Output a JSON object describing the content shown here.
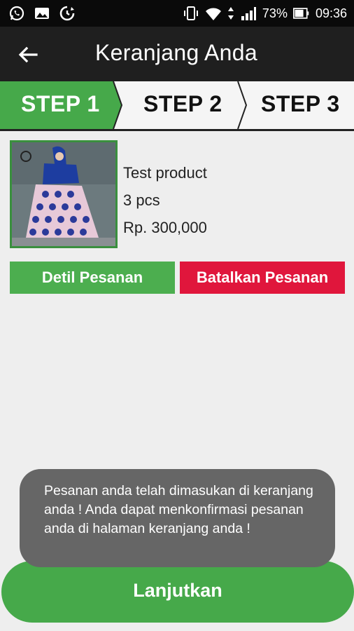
{
  "status_bar": {
    "battery_percent": "73%",
    "time": "09:36",
    "left_icons": [
      "whatsapp-icon",
      "gallery-icon",
      "sync-icon"
    ],
    "right_icons": [
      "vibrate-icon",
      "wifi-icon",
      "data-arrows-icon",
      "signal-icon",
      "battery-icon"
    ]
  },
  "app_bar": {
    "title": "Keranjang Anda",
    "back_icon": "arrow-back-icon"
  },
  "steps": [
    {
      "label": "STEP 1",
      "active": true
    },
    {
      "label": "STEP 2",
      "active": false
    },
    {
      "label": "STEP 3",
      "active": false
    }
  ],
  "product": {
    "name": "Test product",
    "quantity": "3 pcs",
    "price": "Rp. 300,000"
  },
  "actions": {
    "detail_label": "Detil Pesanan",
    "cancel_label": "Batalkan Pesanan"
  },
  "toast": {
    "message": "Pesanan anda telah dimasukan di keranjang anda ! Anda dapat menkonfirmasi pesanan anda di halaman keranjang anda !"
  },
  "continue": {
    "label": "Lanjutkan"
  },
  "colors": {
    "accent_green": "#4cae4f",
    "cancel_red": "#e0163c",
    "app_bar": "#1f1f1f"
  }
}
